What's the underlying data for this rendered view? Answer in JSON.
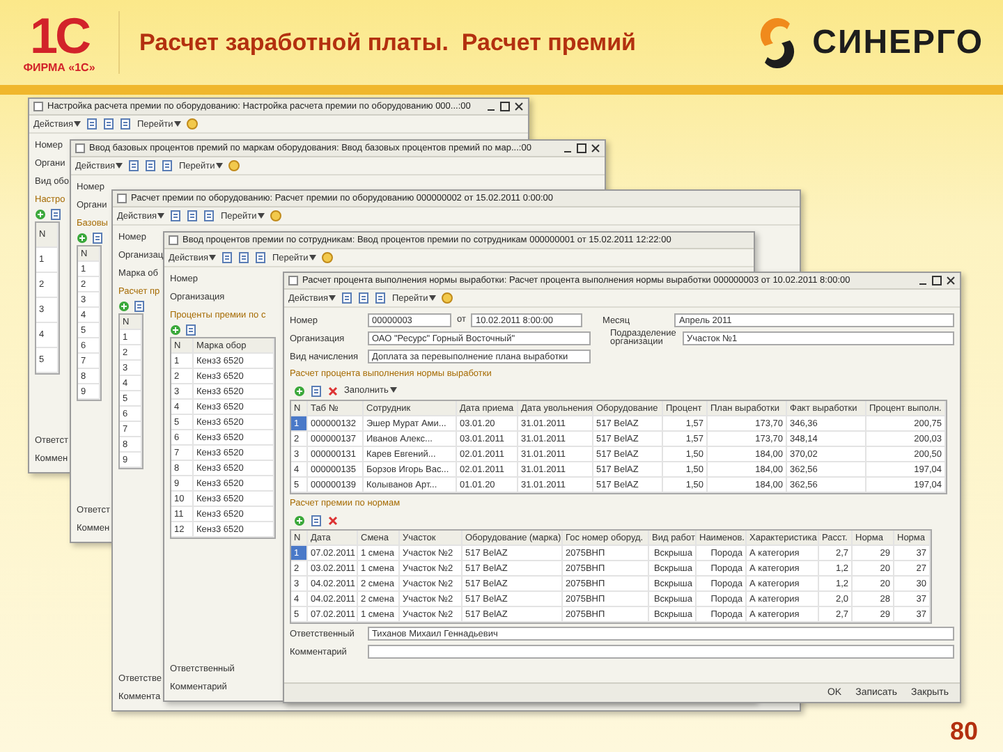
{
  "header": {
    "logo": "1С",
    "logo_caption": "ФИРМА «1С»",
    "title": "Расчет заработной платы.  Расчет премий",
    "brand": "СИНЕРГО"
  },
  "windows": [
    {
      "kind": "back",
      "controls": true,
      "title": "Настройка расчета премии по оборудованию: Настройка расчета премии по оборудованию 000...:00",
      "menu": [
        "Действия",
        "Перейти"
      ],
      "fields": [
        "Номер",
        "Органи",
        "Вид обо"
      ],
      "section": "Настро",
      "rows": [
        [
          "N"
        ],
        [
          "1"
        ],
        [
          "2"
        ],
        [
          "3"
        ],
        [
          "4"
        ],
        [
          "5"
        ]
      ],
      "footer": [
        "Ответст",
        "Коммен"
      ]
    },
    {
      "kind": "back",
      "controls": true,
      "title": "Ввод базовых процентов премий по маркам оборудования: Ввод базовых процентов премий по мар...:00",
      "menu": [
        "Действия",
        "Перейти"
      ],
      "fields": [
        "Номер",
        "Органи"
      ],
      "section": "Базовы",
      "rows": [
        [
          "N"
        ],
        [
          "1"
        ],
        [
          "2"
        ],
        [
          "3"
        ],
        [
          "4"
        ],
        [
          "5"
        ],
        [
          "6"
        ],
        [
          "7"
        ],
        [
          "8"
        ],
        [
          "9"
        ]
      ],
      "footer": [
        "Ответст",
        "Коммен"
      ]
    },
    {
      "kind": "back",
      "controls": false,
      "title": "Расчет премии по оборудованию: Расчет премии по оборудованию 000000002 от 15.02.2011 0:00:00",
      "menu": [
        "Действия",
        "Перейти"
      ],
      "fields": [
        "Номер",
        "Организац",
        "Марка об"
      ],
      "section": "Расчет пр",
      "rows": [
        [
          "N"
        ],
        [
          "1"
        ],
        [
          "2"
        ],
        [
          "3"
        ],
        [
          "4"
        ],
        [
          "5"
        ],
        [
          "6"
        ],
        [
          "7"
        ],
        [
          "8"
        ],
        [
          "9"
        ]
      ],
      "footer": [
        "Ответстве",
        "Коммента"
      ]
    },
    {
      "kind": "back",
      "controls": false,
      "title": "Ввод процентов премии по сотрудникам: Ввод процентов премии по сотрудникам 000000001 от 15.02.2011 12:22:00",
      "menu": [
        "Действия",
        "Перейти"
      ],
      "fields": [
        "Номер",
        "Организация"
      ],
      "section": "Проценты премии по с",
      "rows": [
        [
          "N",
          "Марка обор"
        ],
        [
          "1",
          "Кенз3 6520"
        ],
        [
          "2",
          "Кенз3 6520"
        ],
        [
          "3",
          "Кенз3 6520"
        ],
        [
          "4",
          "Кенз3 6520"
        ],
        [
          "5",
          "Кенз3 6520"
        ],
        [
          "6",
          "Кенз3 6520"
        ],
        [
          "7",
          "Кенз3 6520"
        ],
        [
          "8",
          "Кенз3 6520"
        ],
        [
          "9",
          "Кенз3 6520"
        ],
        [
          "10",
          "Кенз3 6520"
        ],
        [
          "11",
          "Кенз3 6520"
        ],
        [
          "12",
          "Кенз3 6520"
        ]
      ],
      "footer": [
        "Ответственный",
        "Комментарий"
      ]
    },
    {
      "kind": "main",
      "controls": true,
      "title": "Расчет процента выполнения нормы выработки: Расчет процента выполнения нормы выработки 000000003 от 10.02.2011 8:00:00",
      "menu": [
        "Действия",
        "Перейти"
      ],
      "fields": [
        {
          "label": "Номер",
          "value": "00000003"
        },
        {
          "label": "от",
          "value": "10.02.2011 8:00:00"
        },
        {
          "label": "Месяц",
          "value": "Апрель 2011"
        },
        {
          "label": "Организация",
          "value": "ОАО \"Ресурс\" Горный Восточный\""
        },
        {
          "label": "Подразделение организации",
          "value": "Участок №1"
        },
        {
          "label": "Вид начисления",
          "value": "Доплата за перевыполнение плана выработки"
        }
      ],
      "table1": {
        "title": "Расчет процента выполнения нормы выработки",
        "fill": "Заполнить",
        "columns": [
          "N",
          "Таб №",
          "Сотрудник",
          "Дата приема",
          "Дата увольнения",
          "Оборудование",
          "Процент",
          "План выработки",
          "Факт выработки",
          "Процент выполн."
        ],
        "rows": [
          {
            "selected": true,
            "cells": [
              "1",
              "000000132",
              "Эшер Мурат Ами...",
              "03.01.20",
              "31.01.2011",
              "517 BelAZ",
              "1,57",
              "173,70",
              "346,36",
              "200,75"
            ]
          },
          {
            "selected": false,
            "cells": [
              "2",
              "000000137",
              "Иванов Алекс...",
              "03.01.2011",
              "31.01.2011",
              "517 BelAZ",
              "1,57",
              "173,70",
              "348,14",
              "200,03"
            ]
          },
          {
            "selected": false,
            "cells": [
              "3",
              "000000131",
              "Карев Евгений...",
              "02.01.2011",
              "31.01.2011",
              "517 BelAZ",
              "1,50",
              "184,00",
              "370,02",
              "200,50"
            ]
          },
          {
            "selected": false,
            "cells": [
              "4",
              "000000135",
              "Борзов Игорь Вас...",
              "02.01.2011",
              "31.01.2011",
              "517 BelAZ",
              "1,50",
              "184,00",
              "362,56",
              "197,04"
            ]
          },
          {
            "selected": false,
            "cells": [
              "5",
              "000000139",
              "Колыванов Арт...",
              "01.01.20",
              "31.01.2011",
              "517 BelAZ",
              "1,50",
              "184,00",
              "362,56",
              "197,04"
            ]
          }
        ]
      },
      "table2": {
        "title": "Расчет премии по нормам",
        "columns": [
          "N",
          "Дата",
          "Смена",
          "Участок",
          "Оборудование (марка)",
          "Гос номер оборуд.",
          "Вид работ",
          "Наименов.",
          "Характеристика",
          "Расст.",
          "Норма",
          "Норма"
        ],
        "rows": [
          {
            "selected": true,
            "cells": [
              "1",
              "07.02.2011",
              "1 смена",
              "Участок №2",
              "517 BelAZ",
              "2075ВНП",
              "Вскрыша",
              "Порода",
              "А категория",
              "2,7",
              "29",
              "37"
            ]
          },
          {
            "selected": false,
            "cells": [
              "2",
              "03.02.2011",
              "1 смена",
              "Участок №2",
              "517 BelAZ",
              "2075ВНП",
              "Вскрыша",
              "Порода",
              "А категория",
              "1,2",
              "20",
              "27"
            ]
          },
          {
            "selected": false,
            "cells": [
              "3",
              "04.02.2011",
              "2 смена",
              "Участок №2",
              "517 BelAZ",
              "2075ВНП",
              "Вскрыша",
              "Порода",
              "А категория",
              "1,2",
              "20",
              "30"
            ]
          },
          {
            "selected": false,
            "cells": [
              "4",
              "04.02.2011",
              "2 смена",
              "Участок №2",
              "517 BelAZ",
              "2075ВНП",
              "Вскрыша",
              "Порода",
              "А категория",
              "2,0",
              "28",
              "37"
            ]
          },
          {
            "selected": false,
            "cells": [
              "5",
              "07.02.2011",
              "1 смена",
              "Участок №2",
              "517 BelAZ",
              "2075ВНП",
              "Вскрыша",
              "Порода",
              "А категория",
              "2,7",
              "29",
              "37"
            ]
          }
        ]
      },
      "responsible": {
        "label": "Ответственный",
        "value": "Тиханов Михаил Геннадьевич"
      },
      "comment": {
        "label": "Комментарий"
      },
      "buttons": [
        "OK",
        "Записать",
        "Закрыть"
      ]
    }
  ],
  "page_number": "80"
}
